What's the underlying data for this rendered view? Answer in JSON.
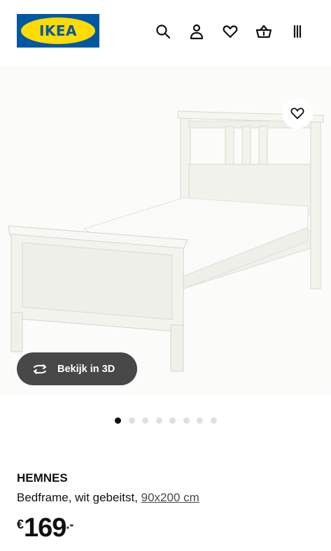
{
  "header": {
    "logo_text": "IKEA",
    "icons": [
      "search-icon",
      "account-icon",
      "favourites-icon",
      "basket-icon",
      "menu-icon"
    ]
  },
  "gallery": {
    "view_3d_label": "Bekijk in 3D",
    "dot_count": 8,
    "active_dot": 0
  },
  "product": {
    "name": "HEMNES",
    "description": "Bedframe, wit gebeitst, ",
    "size": "90x200 cm",
    "price_currency": "€",
    "price_whole": "169",
    "price_decimal": ".-"
  },
  "colors": {
    "ikea_blue": "#0058a3",
    "ikea_yellow": "#ffdb00",
    "button_dark": "#484848"
  }
}
